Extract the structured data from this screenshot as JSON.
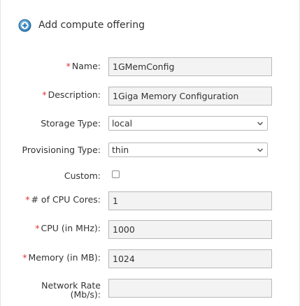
{
  "dialog": {
    "title": "Add compute offering",
    "icon": "plus-circle-icon",
    "accent_color": "#2a7ab8"
  },
  "fields": {
    "name": {
      "label": "Name:",
      "required": true,
      "value": "1GMemConfig"
    },
    "description": {
      "label": "Description:",
      "required": true,
      "value": "1Giga Memory Configuration"
    },
    "storage_type": {
      "label": "Storage Type:",
      "selected": "local"
    },
    "provisioning_type": {
      "label": "Provisioning Type:",
      "selected": "thin"
    },
    "custom": {
      "label": "Custom:",
      "checked": false
    },
    "cpu_cores": {
      "label": "# of CPU Cores:",
      "required": true,
      "value": "1"
    },
    "cpu_mhz": {
      "label": "CPU (in MHz):",
      "required": true,
      "value": "1000"
    },
    "memory_mb": {
      "label": "Memory (in MB):",
      "required": true,
      "value": "1024"
    },
    "network_rate": {
      "label": "Network Rate (Mb/s):",
      "value": ""
    }
  },
  "required_marker": "*",
  "required_color": "#e0322e"
}
